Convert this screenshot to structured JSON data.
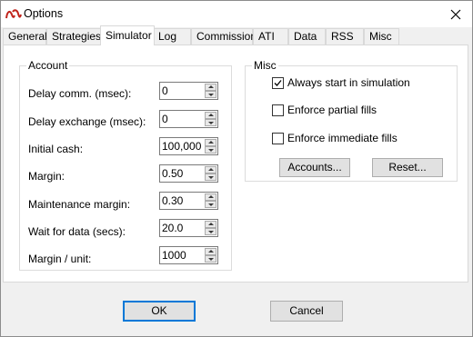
{
  "window": {
    "title": "Options",
    "icon": "app-logo-icon",
    "close_icon": "close-icon"
  },
  "tabs": [
    {
      "label": "General"
    },
    {
      "label": "Strategies"
    },
    {
      "label": "Simulator",
      "active": true
    },
    {
      "label": "Log"
    },
    {
      "label": "Commission"
    },
    {
      "label": "ATI"
    },
    {
      "label": "Data"
    },
    {
      "label": "RSS"
    },
    {
      "label": "Misc"
    }
  ],
  "account": {
    "legend": "Account",
    "fields": [
      {
        "label": "Delay comm. (msec):",
        "value": "0"
      },
      {
        "label": "Delay exchange (msec):",
        "value": "0"
      },
      {
        "label": "Initial cash:",
        "value": "100,000"
      },
      {
        "label": "Margin:",
        "value": "0.50"
      },
      {
        "label": "Maintenance margin:",
        "value": "0.30"
      },
      {
        "label": "Wait for data (secs):",
        "value": "20.0"
      },
      {
        "label": "Margin / unit:",
        "value": "1000"
      }
    ]
  },
  "misc": {
    "legend": "Misc",
    "checkboxes": [
      {
        "label": "Always start in simulation",
        "checked": true
      },
      {
        "label": "Enforce partial fills",
        "checked": false
      },
      {
        "label": "Enforce immediate fills",
        "checked": false
      }
    ],
    "accounts_button": "Accounts...",
    "reset_button": "Reset..."
  },
  "footer": {
    "ok": "OK",
    "cancel": "Cancel"
  },
  "colors": {
    "focus_border": "#0078d7",
    "panel_bg": "#ffffff",
    "dialog_bg": "#f0f0f0"
  }
}
